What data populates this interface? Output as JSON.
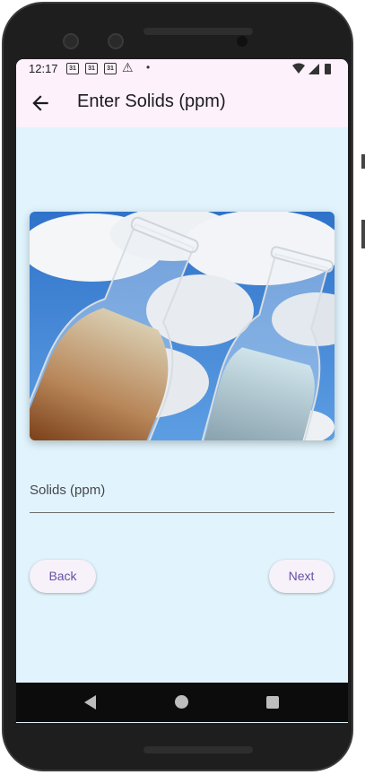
{
  "status_bar": {
    "time": "12:17",
    "calendar_icons": [
      "31",
      "31",
      "31"
    ],
    "icons": [
      "warning-icon",
      "dot-icon",
      "wifi-icon",
      "signal-icon",
      "battery-icon"
    ]
  },
  "app_bar": {
    "back_icon": "arrow-back-icon",
    "title": "Enter Solids (ppm)"
  },
  "main": {
    "image_description_icon": "water-beakers-photo",
    "field": {
      "label": "Solids (ppm)",
      "value": ""
    },
    "buttons": {
      "back_label": "Back",
      "next_label": "Next"
    }
  },
  "colors": {
    "background": "#e1f4fd",
    "app_bar": "#fdf1fb",
    "button_text": "#6750a4",
    "button_bg": "#f7f2fa"
  },
  "nav_bar": {
    "icons": [
      "nav-back-icon",
      "nav-home-icon",
      "nav-recents-icon"
    ]
  }
}
